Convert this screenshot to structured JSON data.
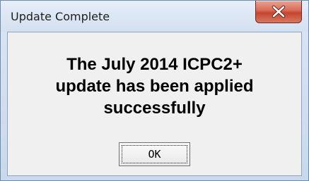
{
  "window": {
    "title": "Update Complete"
  },
  "titlebar": {
    "close_icon": "close-x-icon"
  },
  "message": {
    "line1": "The July 2014 ICPC2+",
    "line2": "update has been applied",
    "line3": "successfully"
  },
  "buttons": {
    "ok_label": "OK"
  },
  "colors": {
    "close_button": "#c4452f",
    "client_background": "#f0f0f0",
    "frame": "#d3e0f0"
  }
}
